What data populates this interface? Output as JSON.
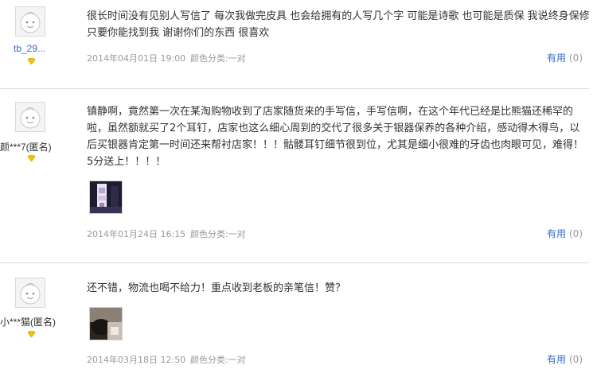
{
  "reviews": [
    {
      "user": "tb_29...",
      "content": "很长时间没有见别人写信了 每次我做完皮具 也会给拥有的人写几个字 可能是诗歌 也可能是质保 我说终身保修 只要你能找到我 谢谢你们的东西 很喜欢",
      "date": "2014年04月01日 19:00",
      "category": "颜色分类:一对",
      "useful_label": "有用",
      "useful_count": "(0)"
    },
    {
      "user": "颜***7(匿名)",
      "content": "镇静啊，竟然第一次在某淘购物收到了店家随货来的手写信，手写信啊，在这个年代已经是比熊猫还稀罕的啦，虽然额就买了2个耳钉，店家也这么细心周到的交代了很多关于银器保养的各种介绍，感动得木得鸟，以后买银器肯定第一时间还来帮衬店家！！！骷髅耳钉细节很到位，尤其是细小很难的牙齿也肉眼可见，难得！5分送上！！！！",
      "date": "2014年01月24日 16:15",
      "category": "颜色分类:一对",
      "useful_label": "有用",
      "useful_count": "(0)"
    },
    {
      "user": "小***猫(匿名)",
      "content": "还不错，物流也喝不给力！重点收到老板的亲笔信！赞？",
      "date": "2014年03月18日 12:50",
      "category": "颜色分类:一对",
      "useful_label": "有用",
      "useful_count": "(0)"
    }
  ],
  "colors": {
    "link": "#3a6bc0",
    "meta": "#999999",
    "separator": "#dcdcdc",
    "badge": "#f2c200"
  }
}
